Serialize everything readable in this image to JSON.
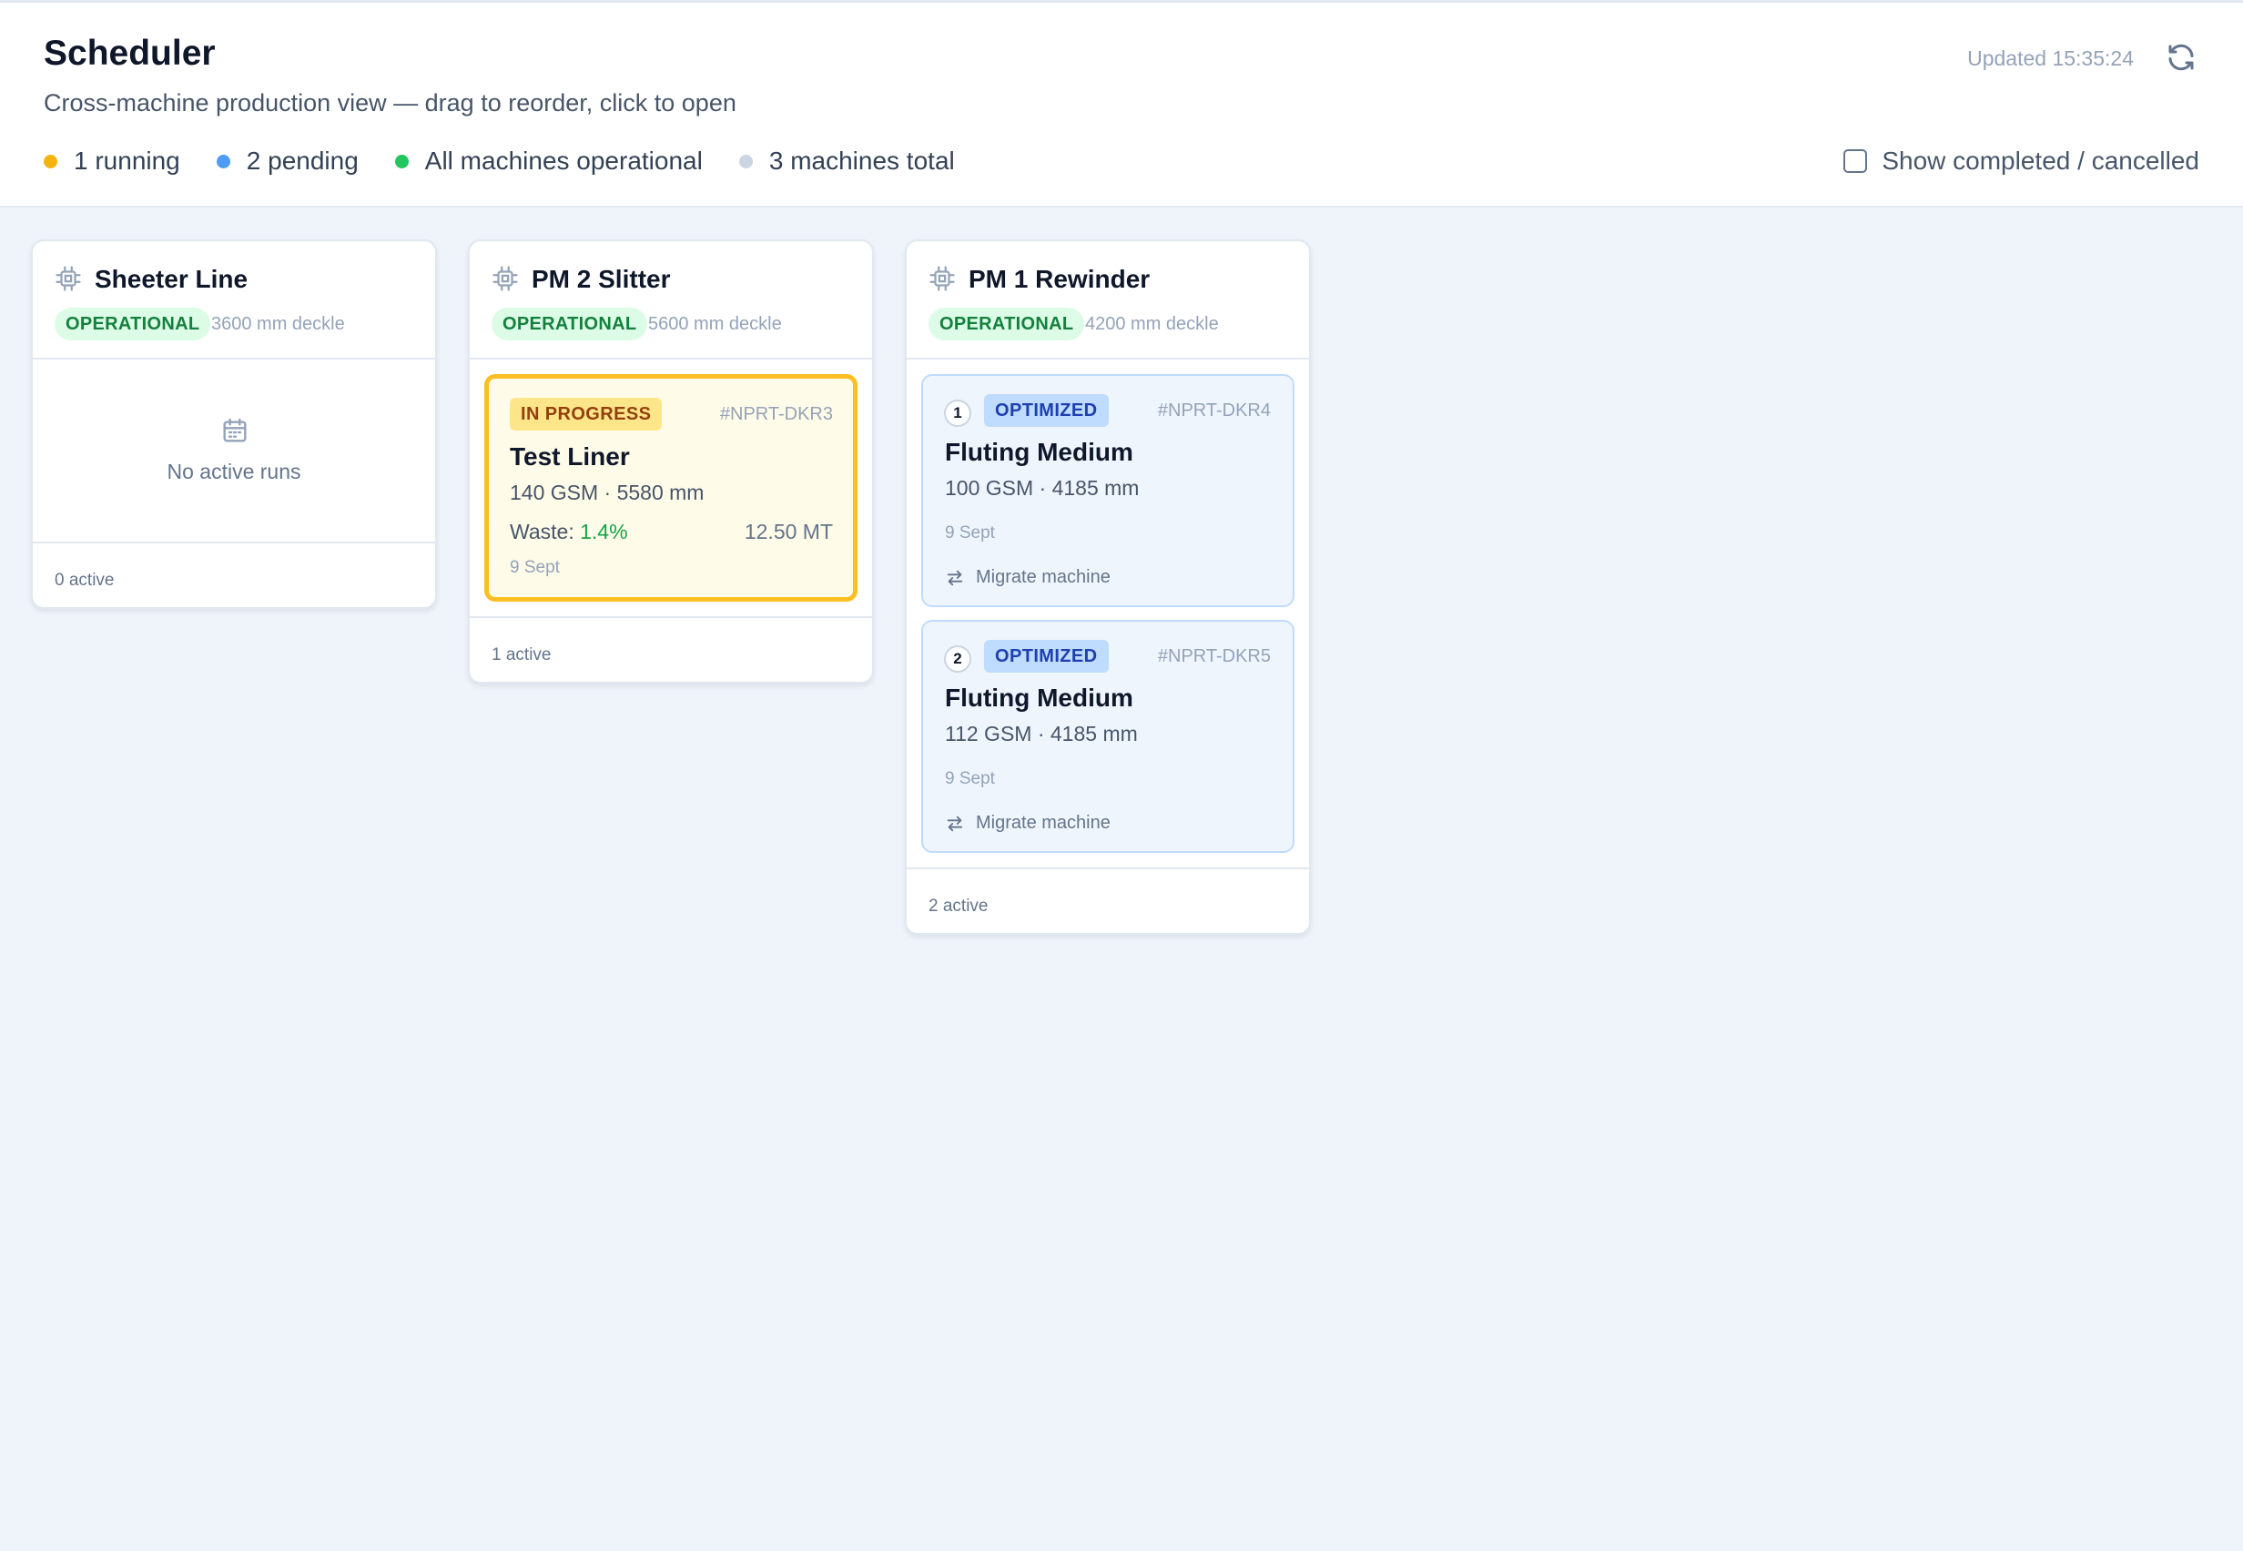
{
  "header": {
    "title": "Scheduler",
    "subtitle": "Cross-machine production view — drag to reorder, click to open",
    "updated": "Updated 15:35:24",
    "refresh_icon": "refresh-icon",
    "stats": [
      {
        "label": "1 running",
        "color": "#f5b40c"
      },
      {
        "label": "2 pending",
        "color": "#4e9cf6"
      },
      {
        "label": "All machines operational",
        "color": "#22c55e"
      },
      {
        "label": "3 machines total",
        "color": "#cbd5e1"
      }
    ],
    "show_completed_label": "Show completed / cancelled"
  },
  "columns": [
    {
      "name": "Sheeter Line",
      "status": "OPERATIONAL",
      "deckle": "3600 mm deckle",
      "empty_text": "No active runs",
      "footer": "0 active"
    },
    {
      "name": "PM 2 Slitter",
      "status": "OPERATIONAL",
      "deckle": "5600 mm deckle",
      "footer": "1 active",
      "cards": [
        {
          "status": "IN PROGRESS",
          "code": "#NPRT-DKR3",
          "product": "Test Liner",
          "spec": "140 GSM · 5580 mm",
          "waste_label": "Waste:",
          "waste_value": "1.4%",
          "tons": "12.50 MT",
          "date": "9 Sept"
        }
      ]
    },
    {
      "name": "PM 1 Rewinder",
      "status": "OPERATIONAL",
      "deckle": "4200 mm deckle",
      "footer": "2 active",
      "cards": [
        {
          "seq": "1",
          "status": "OPTIMIZED",
          "code": "#NPRT-DKR4",
          "product": "Fluting Medium",
          "spec": "100 GSM · 4185 mm",
          "date": "9 Sept",
          "action": "Migrate machine"
        },
        {
          "seq": "2",
          "status": "OPTIMIZED",
          "code": "#NPRT-DKR5",
          "product": "Fluting Medium",
          "spec": "112 GSM · 4185 mm",
          "date": "9 Sept",
          "action": "Migrate machine"
        }
      ]
    }
  ]
}
